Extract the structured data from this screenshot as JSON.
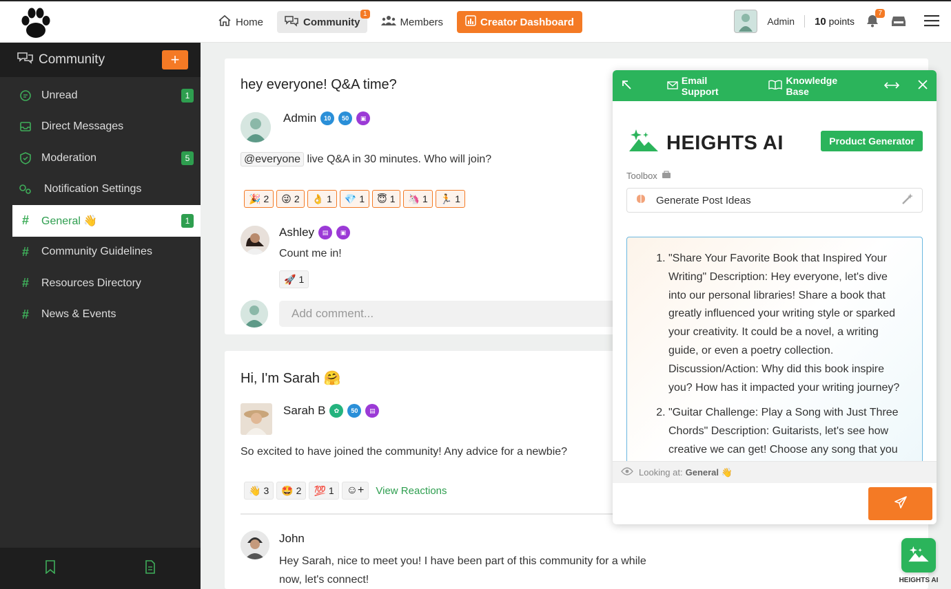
{
  "nav": {
    "home": "Home",
    "community": "Community",
    "community_badge": "1",
    "members": "Members",
    "creator": "Creator Dashboard"
  },
  "user": {
    "name": "Admin",
    "points_value": "10",
    "points_label": "points",
    "bell_badge": "7"
  },
  "sidebar": {
    "title": "Community",
    "add": "+",
    "items": [
      {
        "label": "Unread",
        "badge": "1"
      },
      {
        "label": "Direct Messages"
      },
      {
        "label": "Moderation",
        "badge": "5"
      },
      {
        "label": "Notification Settings"
      },
      {
        "label": "General 👋",
        "badge": "1"
      },
      {
        "label": "Community Guidelines"
      },
      {
        "label": "Resources Directory"
      },
      {
        "label": "News & Events"
      }
    ]
  },
  "post1": {
    "title": "hey everyone! Q&A time?",
    "author": "Admin",
    "badges": [
      "10",
      "50"
    ],
    "mention": "@everyone",
    "text": " live Q&A in 30 minutes. Who will join?",
    "reactions": [
      {
        "emoji": "🎉",
        "count": "2"
      },
      {
        "emoji": "😜",
        "count": "2"
      },
      {
        "emoji": "👌",
        "count": "1"
      },
      {
        "emoji": "💎",
        "count": "1"
      },
      {
        "emoji": "😇",
        "count": "1"
      },
      {
        "emoji": "🦄",
        "count": "1"
      },
      {
        "emoji": "🏃",
        "count": "1"
      }
    ],
    "comment_author": "Ashley",
    "comment_text": "Count me in!",
    "comment_reaction": {
      "emoji": "🚀",
      "count": "1"
    },
    "comment_placeholder": "Add comment..."
  },
  "post2": {
    "title": "Hi, I'm Sarah 🤗",
    "author": "Sarah B",
    "badge_mid": "50",
    "text": "So excited to have joined the community! Any advice for a newbie?",
    "reactions": [
      {
        "emoji": "👋",
        "count": "3"
      },
      {
        "emoji": "🤩",
        "count": "2"
      },
      {
        "emoji": "💯",
        "count": "1"
      }
    ],
    "add_reaction": "☺+",
    "view_reactions": "View Reactions",
    "reply_author": "John",
    "reply_text_1": "Hey Sarah, nice to meet you! I have been part of this community for a while",
    "reply_text_2": "now, let's connect!"
  },
  "ai_panel": {
    "email_support": "Email Support",
    "knowledge_base": "Knowledge Base",
    "title": "HEIGHTS AI",
    "product_generator": "Product Generator",
    "toolbox_label": "Toolbox",
    "tool_selected": "Generate Post Ideas",
    "answers": [
      "\"Share Your Favorite Book that Inspired Your Writing\" Description: Hey everyone, let's dive into our personal libraries! Share a book that greatly influenced your writing style or sparked your creativity. It could be a novel, a writing guide, or even a poetry collection. Discussion/Action: Why did this book inspire you? How has it impacted your writing journey?",
      "\"Guitar Challenge: Play a Song with Just Three Chords\" Description: Guitarists, let's see how creative we can get! Choose any song that you"
    ],
    "looking_prefix": "Looking at:",
    "looking_value": "General 👋"
  },
  "fab_label": "HEIGHTS AI",
  "colors": {
    "brand_green": "#2bb45b",
    "accent_orange": "#f47a25",
    "sidebar_bg": "#2b2b2b"
  }
}
